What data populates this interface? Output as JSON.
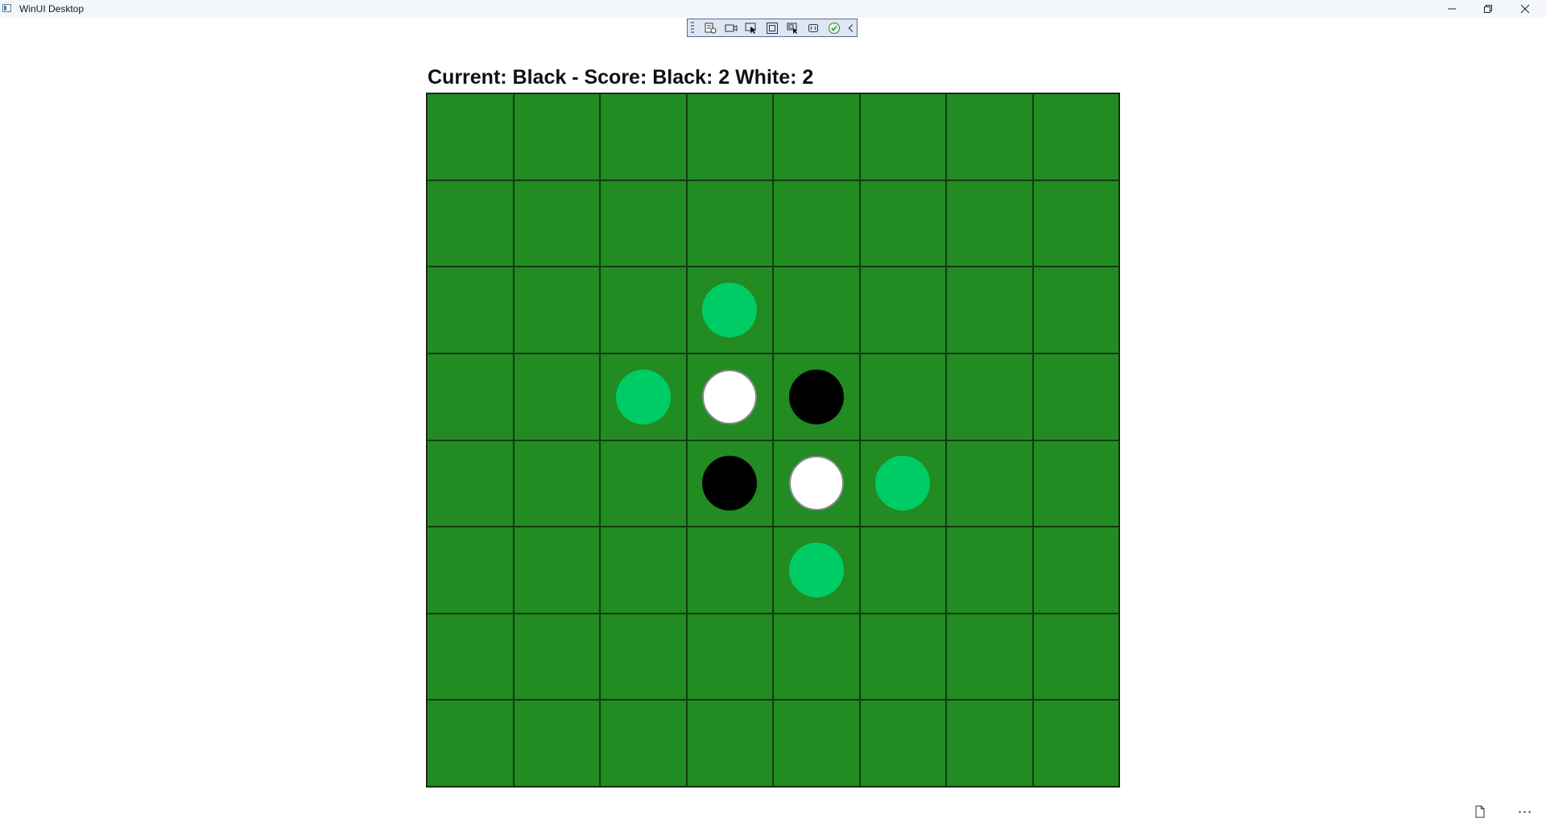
{
  "window": {
    "title": "WinUI Desktop",
    "minimize_glyph": "—",
    "maximize_glyph": "❐",
    "close_glyph": "✕"
  },
  "debug_toolbar": {
    "buttons": [
      {
        "name": "live-visual-tree-icon"
      },
      {
        "name": "record-icon"
      },
      {
        "name": "select-element-icon"
      },
      {
        "name": "display-layout-adorners-icon"
      },
      {
        "name": "track-focus-icon"
      },
      {
        "name": "binding-failures-icon"
      },
      {
        "name": "accessibility-check-icon"
      },
      {
        "name": "collapse-chevron-icon"
      }
    ]
  },
  "status": {
    "text": "Current: Black - Score: Black: 2 White: 2"
  },
  "game": {
    "board_size": 8,
    "current_player": "Black",
    "score": {
      "black": 2,
      "white": 2
    },
    "colors": {
      "board": "#228b22",
      "grid_line": "#123d12",
      "black_disc": "#000000",
      "white_disc": "#ffffff",
      "valid_move_hint": "#00cc66"
    },
    "pieces": [
      {
        "row": 3,
        "col": 3,
        "color": "white"
      },
      {
        "row": 3,
        "col": 4,
        "color": "black"
      },
      {
        "row": 4,
        "col": 3,
        "color": "black"
      },
      {
        "row": 4,
        "col": 4,
        "color": "white"
      }
    ],
    "valid_moves": [
      {
        "row": 2,
        "col": 3
      },
      {
        "row": 3,
        "col": 2
      },
      {
        "row": 4,
        "col": 5
      },
      {
        "row": 5,
        "col": 4
      }
    ]
  },
  "bottom_bar": {
    "document_icon": "document-icon",
    "more_glyph": "⋯"
  }
}
